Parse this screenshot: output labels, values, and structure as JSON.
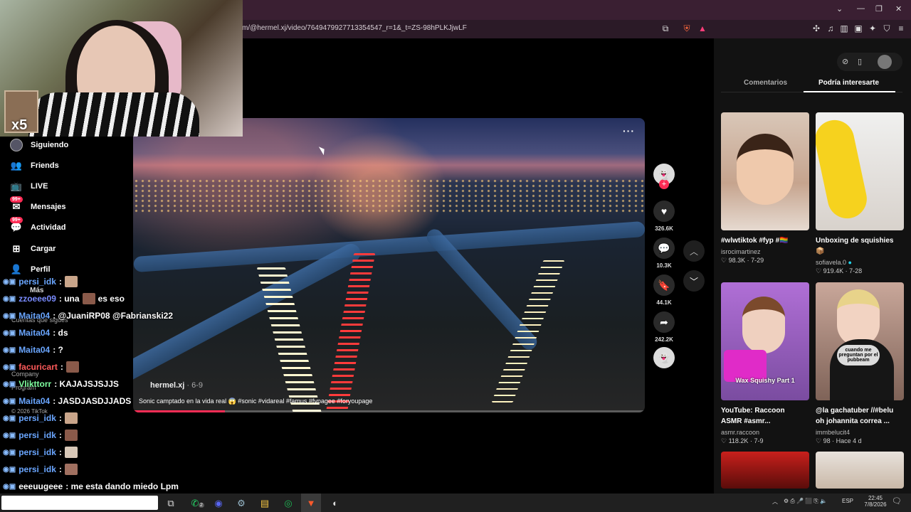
{
  "browser": {
    "url": "m/@hermel.xj/video/7649479927713354547_r=1&_t=ZS-98hPLKJjwLF",
    "controls": [
      "minimize-icon",
      "maximize-icon",
      "close-icon"
    ]
  },
  "webcam": {
    "multiplier": "x5"
  },
  "sidebar": {
    "items": [
      {
        "label": "Siguiendo",
        "icon": "avatar-icon"
      },
      {
        "label": "Friends",
        "icon": "friends-icon"
      },
      {
        "label": "LIVE",
        "icon": "live-icon"
      },
      {
        "label": "Mensajes",
        "icon": "messages-icon",
        "badge": "99+"
      },
      {
        "label": "Actividad",
        "icon": "activity-icon",
        "badge": "99+"
      },
      {
        "label": "Cargar",
        "icon": "upload-icon"
      },
      {
        "label": "Perfil",
        "icon": "profile-icon"
      }
    ],
    "more": "Más",
    "following_accounts": "Cuentas que sigues",
    "company": "Company",
    "program": "Program",
    "copyright": "© 2026 TikTok"
  },
  "video": {
    "author": "hermel.xj",
    "date": "6-9",
    "caption": "Sonic camptado en la vida real 😱 #sonic #vidareal #famus #fypagee #foryoupage",
    "progress": 0.18
  },
  "actions": {
    "likes": "326.6K",
    "comments": "10.3K",
    "saves": "44.1K",
    "shares": "242.2K"
  },
  "panel": {
    "tabs": [
      "Comentarios",
      "Podría interesarte"
    ],
    "active_tab": "Podría interesarte",
    "cards": [
      {
        "title": "#wlwtiktok #fyp #🏳️‍🌈",
        "user": "isrocimartinez",
        "likes": "98.3K",
        "date": "7-29"
      },
      {
        "title": "Unboxing de squishies 📦",
        "user": "sofiavela.0",
        "likes": "919.4K",
        "date": "7-28"
      },
      {
        "title": "YouTube: Raccoon ASMR #asmr...",
        "user": "asmr.raccoon",
        "likes": "118.2K",
        "date": "7-9",
        "overlay": "Wax Squishy Part 1"
      },
      {
        "title": "@la gachatuber //#belu oh johannita correa ...",
        "user": "immbelucit4",
        "likes": "98",
        "date": "Hace 4 d",
        "overlay": "cuando me preguntan por el pubbeam"
      }
    ]
  },
  "chat": [
    {
      "user": "persi_idk",
      "text": ":",
      "color": "#6aa6ff"
    },
    {
      "user": "zzoeee09",
      "text": ": una",
      "text2": "es eso",
      "color": "#7a8cff"
    },
    {
      "user": "Maita04",
      "text": ": @JuaniRP08 @Fabrianski22",
      "color": "#6aa6ff"
    },
    {
      "user": "Maita04",
      "text": ": ds",
      "color": "#6aa6ff"
    },
    {
      "user": "Maita04",
      "text": ": ?",
      "color": "#6aa6ff"
    },
    {
      "user": "facuricart",
      "text": ":",
      "color": "#ff5a5a"
    },
    {
      "user": "Vlikttorr",
      "text": ": KAJAJSJSJJS",
      "color": "#7fffa0"
    },
    {
      "user": "Maita04",
      "text": ": JASDJASDJJADS",
      "color": "#6aa6ff"
    },
    {
      "user": "persi_idk",
      "text": ":",
      "color": "#6aa6ff"
    },
    {
      "user": "persi_idk",
      "text": ":",
      "color": "#6aa6ff"
    },
    {
      "user": "persi_idk",
      "text": ":",
      "color": "#6aa6ff"
    },
    {
      "user": "persi_idk",
      "text": ":",
      "color": "#6aa6ff"
    },
    {
      "user": "eeeuugeee",
      "text": ": me esta dando miedo Lpm",
      "color": "#ffffff"
    },
    {
      "user": "persi_idk",
      "text": ":",
      "color": "#6aa6ff"
    }
  ],
  "taskbar": {
    "lang": "ESP",
    "time": "22:45",
    "date": "7/8/2026",
    "whatsapp_badge": "2"
  }
}
